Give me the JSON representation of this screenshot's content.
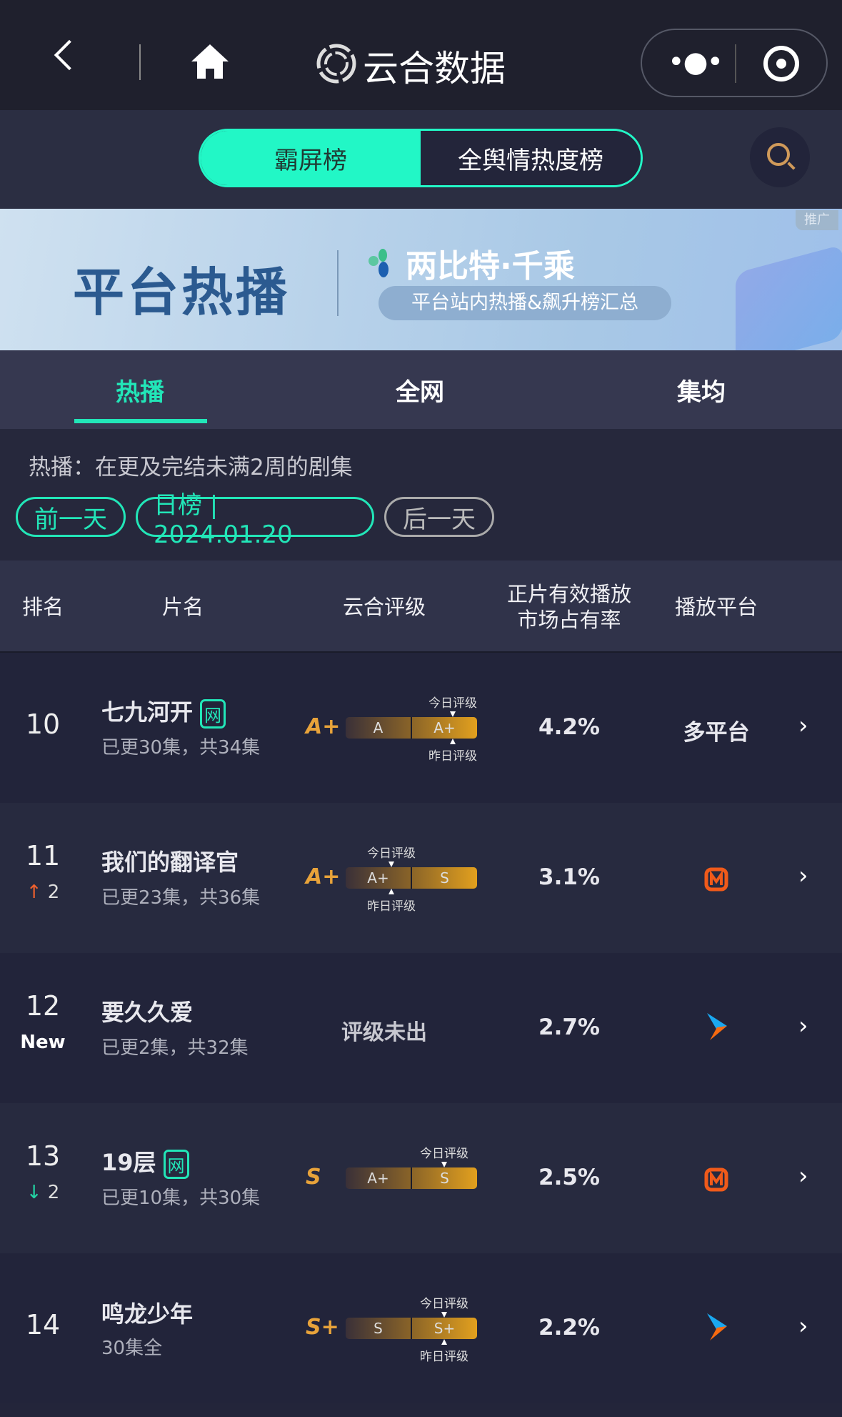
{
  "nav": {
    "title": "云合数据"
  },
  "toggle": {
    "active": "霸屏榜",
    "inactive": "全舆情热度榜"
  },
  "banner": {
    "headline": "平台热播",
    "brand": "两比特·千乘",
    "subtitle": "平台站内热播&飙升榜汇总",
    "ad_tag": "推广"
  },
  "tabs": [
    {
      "label": "热播",
      "active": true
    },
    {
      "label": "全网"
    },
    {
      "label": "集均"
    }
  ],
  "info": {
    "description": "热播：在更及完结未满2周的剧集",
    "prev_day": "前一天",
    "date_label": "日榜 | 2024.01.20",
    "next_day": "后一天"
  },
  "columns": {
    "rank": "排名",
    "title": "片名",
    "rating": "云合评级",
    "share_line1": "正片有效播放",
    "share_line2": "市场占有率",
    "platform": "播放平台"
  },
  "markers": {
    "today": "今日评级",
    "yesterday": "昨日评级"
  },
  "no_rating": "评级未出",
  "colors": {
    "accent": "#22f7c6",
    "grade": "#e8a33a",
    "up": "#f0612e",
    "down": "#22d6a5"
  },
  "rows": [
    {
      "rank": "10",
      "change": "",
      "title": "七九河开",
      "net": "网",
      "episodes": "已更30集，共34集",
      "grade": "A+",
      "bar": [
        "A",
        "A+"
      ],
      "today_pos": 1,
      "yest_pos": 1,
      "share": "4.2%",
      "platform": "多平台",
      "platform_icon": ""
    },
    {
      "rank": "11",
      "change": "↑ 2",
      "change_dir": "up",
      "title": "我们的翻译官",
      "net": "",
      "episodes": "已更23集，共36集",
      "grade": "A+",
      "bar": [
        "A+",
        "S"
      ],
      "today_pos": 0,
      "yest_pos": 0,
      "share": "3.1%",
      "platform": "",
      "platform_icon": "mango-tv-icon"
    },
    {
      "rank": "12",
      "change": "New",
      "title": "要久久爱",
      "net": "",
      "episodes": "已更2集，共32集",
      "grade": "",
      "bar": [],
      "share": "2.7%",
      "platform": "",
      "platform_icon": "youku-icon"
    },
    {
      "rank": "13",
      "change": "↓ 2",
      "change_dir": "down",
      "title": "19层",
      "net": "网",
      "episodes": "已更10集，共30集",
      "grade": "S",
      "bar": [
        "A+",
        "S"
      ],
      "today_pos": 1,
      "share": "2.5%",
      "platform": "",
      "platform_icon": "mango-tv-icon"
    },
    {
      "rank": "14",
      "change": "",
      "title": "鸣龙少年",
      "net": "",
      "episodes": "30集全",
      "grade": "S+",
      "bar": [
        "S",
        "S+"
      ],
      "today_pos": 1,
      "yest_pos": 1,
      "share": "2.2%",
      "platform": "",
      "platform_icon": "youku-icon"
    }
  ]
}
